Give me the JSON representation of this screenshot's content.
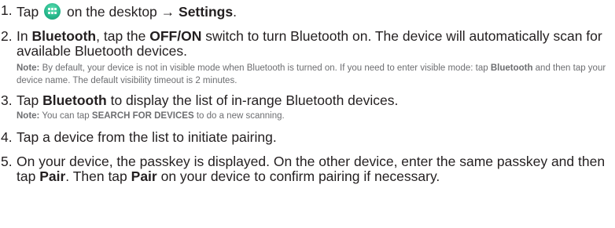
{
  "steps": [
    {
      "num": "1.",
      "pre": "Tap",
      "icon": "apps-launcher-icon",
      "post": "on the desktop → ",
      "bold": "Settings",
      "end": "."
    },
    {
      "num": "2.",
      "t1": "In ",
      "b1": "Bluetooth",
      "t2": ", tap the ",
      "b2": "OFF/ON",
      "t3": " switch to turn Bluetooth on. The device will automatically scan for available Bluetooth devices.",
      "note": {
        "label": "Note:",
        "t1": " By default, your device is not in visible mode when Bluetooth is turned on. If you need to enter visible mode: tap ",
        "b1": "Bluetooth",
        "t2": " and then tap your device name. The default visibility timeout is 2 minutes."
      }
    },
    {
      "num": "3.",
      "t1": "Tap ",
      "b1": "Bluetooth",
      "t2": " to display the list of in-range Bluetooth devices.",
      "note": {
        "label": "Note:",
        "t1": " You can tap ",
        "b1": "SEARCH FOR DEVICES",
        "t2": " to do a new scanning."
      }
    },
    {
      "num": "4.",
      "t1": "Tap a device from the list to initiate pairing."
    },
    {
      "num": "5.",
      "t1": "On your device, the passkey is displayed. On the other device, enter the same passkey and then tap ",
      "b1": "Pair",
      "t2": ". Then tap ",
      "b2": "Pair",
      "t3": " on your device to confirm pairing if necessary."
    }
  ]
}
